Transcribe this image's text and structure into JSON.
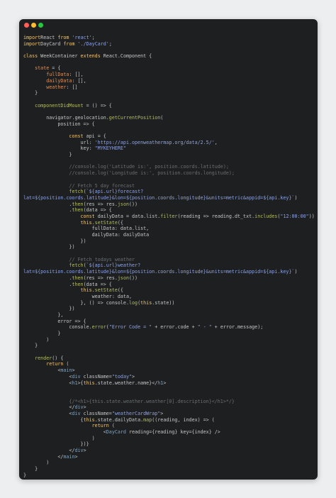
{
  "window": {
    "dots": [
      {
        "name": "close",
        "color": "#ff5f57"
      },
      {
        "name": "minimize",
        "color": "#febc2e"
      },
      {
        "name": "maximize",
        "color": "#28c840"
      }
    ]
  },
  "palette": {
    "keyword": "#f0c674",
    "string": "#8fa3e6",
    "function": "#b5bd68",
    "property": "#de935f",
    "comment": "#6a6f73",
    "plain": "#c5c8c6",
    "background": "#1d1f21"
  },
  "code_lines": [
    [
      [
        "kw",
        "import"
      ],
      [
        "",
        "React"
      ],
      [
        "kw",
        " from "
      ],
      [
        "str",
        "'react'"
      ],
      [
        "",
        ";"
      ]
    ],
    [
      [
        "kw",
        "import"
      ],
      [
        "",
        "DayCard"
      ],
      [
        "kw",
        " from "
      ],
      [
        "str",
        "'./DayCard'"
      ],
      [
        "",
        ";"
      ]
    ],
    [],
    [
      [
        "kw",
        "class"
      ],
      [
        "",
        " WeekContainer "
      ],
      [
        "kw",
        "extends"
      ],
      [
        "",
        " React.Component {"
      ]
    ],
    [],
    [
      [
        "",
        "    "
      ],
      [
        "prop",
        "state"
      ],
      [
        "",
        " = {"
      ]
    ],
    [
      [
        "",
        "        "
      ],
      [
        "prop",
        "fullData"
      ],
      [
        "",
        ": [],"
      ]
    ],
    [
      [
        "",
        "        "
      ],
      [
        "prop",
        "dailyData"
      ],
      [
        "",
        ": [],"
      ]
    ],
    [
      [
        "",
        "        "
      ],
      [
        "prop",
        "weather"
      ],
      [
        "",
        ": []"
      ]
    ],
    [
      [
        "",
        "    }"
      ]
    ],
    [],
    [
      [
        "",
        "    "
      ],
      [
        "fn",
        "componentDidMount"
      ],
      [
        "",
        " = () => {"
      ]
    ],
    [],
    [
      [
        "",
        "        navigator.geolocation."
      ],
      [
        "fn",
        "getCurrentPosition"
      ],
      [
        "",
        "("
      ]
    ],
    [
      [
        "",
        "            position => {"
      ]
    ],
    [],
    [
      [
        "",
        "                "
      ],
      [
        "kw",
        "const"
      ],
      [
        "",
        " api = {"
      ]
    ],
    [
      [
        "",
        "                    url: "
      ],
      [
        "str",
        "'https://api.openweathermap.org/data/2.5/'"
      ],
      [
        "",
        ","
      ]
    ],
    [
      [
        "",
        "                    key: "
      ],
      [
        "str",
        "\"MYKEYHERE\""
      ]
    ],
    [
      [
        "",
        "                }"
      ]
    ],
    [],
    [
      [
        "cm",
        "                //console.log('Latitude is:', position.coords.latitude);"
      ]
    ],
    [
      [
        "cm",
        "                //console.log('Longitude is:', position.coords.longitude);"
      ]
    ],
    [],
    [
      [
        "cm",
        "                // Fetch 5 day forecast"
      ]
    ],
    [
      [
        "",
        "                "
      ],
      [
        "fn",
        "fetch"
      ],
      [
        "",
        "("
      ],
      [
        "str",
        "`${api.url}forecast?"
      ]
    ],
    [
      [
        "str",
        "lat=${position.coords.latitude}&lon=${position.coords.longitude}&units=metric&appid=${api.key}`"
      ],
      [
        "",
        ")"
      ]
    ],
    [
      [
        "",
        "                ."
      ],
      [
        "fn",
        "then"
      ],
      [
        "",
        "(res => res."
      ],
      [
        "fn",
        "json"
      ],
      [
        "",
        "())"
      ]
    ],
    [
      [
        "",
        "                ."
      ],
      [
        "fn",
        "then"
      ],
      [
        "",
        "(data => {"
      ]
    ],
    [
      [
        "",
        "                    "
      ],
      [
        "kw",
        "const"
      ],
      [
        "",
        " dailyData = data.list."
      ],
      [
        "fn",
        "filter"
      ],
      [
        "",
        "(reading => reading.dt_txt."
      ],
      [
        "fn",
        "includes"
      ],
      [
        "",
        "("
      ],
      [
        "str",
        "\"12:00:00\""
      ],
      [
        "",
        "))"
      ]
    ],
    [
      [
        "",
        "                    "
      ],
      [
        "kw",
        "this"
      ],
      [
        "",
        "."
      ],
      [
        "fn",
        "setState"
      ],
      [
        "",
        "({"
      ]
    ],
    [
      [
        "",
        "                        fullData: data.list,"
      ]
    ],
    [
      [
        "",
        "                        dailyData: dailyData"
      ]
    ],
    [
      [
        "",
        "                    })"
      ]
    ],
    [
      [
        "",
        "                })"
      ]
    ],
    [],
    [
      [
        "cm",
        "                // Fetch todays weather"
      ]
    ],
    [
      [
        "",
        "                "
      ],
      [
        "fn",
        "fetch"
      ],
      [
        "",
        "("
      ],
      [
        "str",
        "`${api.url}weather?"
      ]
    ],
    [
      [
        "str",
        "lat=${position.coords.latitude}&lon=${position.coords.longitude}&units=metric&appid=${api.key}`"
      ],
      [
        "",
        ")"
      ]
    ],
    [
      [
        "",
        "                ."
      ],
      [
        "fn",
        "then"
      ],
      [
        "",
        "(res => res."
      ],
      [
        "fn",
        "json"
      ],
      [
        "",
        "())"
      ]
    ],
    [
      [
        "",
        "                ."
      ],
      [
        "fn",
        "then"
      ],
      [
        "",
        "(data => {"
      ]
    ],
    [
      [
        "",
        "                    "
      ],
      [
        "kw",
        "this"
      ],
      [
        "",
        "."
      ],
      [
        "fn",
        "setState"
      ],
      [
        "",
        "({"
      ]
    ],
    [
      [
        "",
        "                        weather: data,"
      ]
    ],
    [
      [
        "",
        "                    }, () => console."
      ],
      [
        "fn",
        "log"
      ],
      [
        "",
        "("
      ],
      [
        "kw",
        "this"
      ],
      [
        "",
        ".state))"
      ]
    ],
    [
      [
        "",
        "                })"
      ]
    ],
    [
      [
        "",
        "            },"
      ]
    ],
    [
      [
        "",
        "            error => {"
      ]
    ],
    [
      [
        "",
        "                console."
      ],
      [
        "fn",
        "error"
      ],
      [
        "",
        "("
      ],
      [
        "str",
        "\"Error Code = \""
      ],
      [
        "",
        " + error.code + "
      ],
      [
        "str",
        "\" - \""
      ],
      [
        "",
        " + error.message);"
      ]
    ],
    [
      [
        "",
        "            }"
      ]
    ],
    [
      [
        "",
        "        )"
      ]
    ],
    [
      [
        "",
        "    }"
      ]
    ],
    [],
    [
      [
        "",
        "    "
      ],
      [
        "fn",
        "render"
      ],
      [
        "",
        "() {"
      ]
    ],
    [
      [
        "",
        "        "
      ],
      [
        "kw",
        "return"
      ],
      [
        "",
        " ("
      ]
    ],
    [
      [
        "",
        "            <"
      ],
      [
        "tag",
        "main"
      ],
      [
        "",
        ">"
      ]
    ],
    [
      [
        "",
        "                <"
      ],
      [
        "tag",
        "div"
      ],
      [
        "",
        " className="
      ],
      [
        "str",
        "\"today\""
      ],
      [
        "",
        ">"
      ]
    ],
    [
      [
        "",
        "                <"
      ],
      [
        "tag",
        "h1"
      ],
      [
        "",
        ">{"
      ],
      [
        "kw",
        "this"
      ],
      [
        "",
        ".state.weather.name}</"
      ],
      [
        "tag",
        "h1"
      ],
      [
        "",
        ">"
      ]
    ],
    [],
    [],
    [
      [
        "",
        "                "
      ],
      [
        "cm",
        "{/*<h1>{this.state.weather.weather[0].description}</h1>*/}"
      ]
    ],
    [
      [
        "",
        "                </"
      ],
      [
        "tag",
        "div"
      ],
      [
        "",
        ">"
      ]
    ],
    [
      [
        "",
        "                <"
      ],
      [
        "tag",
        "div"
      ],
      [
        "",
        " className="
      ],
      [
        "str",
        "\"weatherCardWrap\""
      ],
      [
        "",
        ">"
      ]
    ],
    [
      [
        "",
        "                    {"
      ],
      [
        "kw",
        "this"
      ],
      [
        "",
        ".state.dailyData."
      ],
      [
        "fn",
        "map"
      ],
      [
        "",
        "((reading, index) => ("
      ]
    ],
    [
      [
        "",
        "                        "
      ],
      [
        "kw",
        "return"
      ],
      [
        "",
        " ("
      ]
    ],
    [
      [
        "",
        "                            <"
      ],
      [
        "tag",
        "DayCard"
      ],
      [
        "",
        " reading={reading} key={index} />"
      ]
    ],
    [
      [
        "",
        "                        )"
      ]
    ],
    [
      [
        "",
        "                    })}"
      ]
    ],
    [
      [
        "",
        "                </"
      ],
      [
        "tag",
        "div"
      ],
      [
        "",
        ">"
      ]
    ],
    [
      [
        "",
        "            </"
      ],
      [
        "tag",
        "main"
      ],
      [
        "",
        ">"
      ]
    ],
    [
      [
        "",
        "        )"
      ]
    ],
    [
      [
        "",
        "    }"
      ]
    ],
    [
      [
        "",
        "}"
      ]
    ],
    [],
    [
      [
        "kw",
        "export default"
      ],
      [
        "",
        " WeekContainer;"
      ]
    ]
  ]
}
